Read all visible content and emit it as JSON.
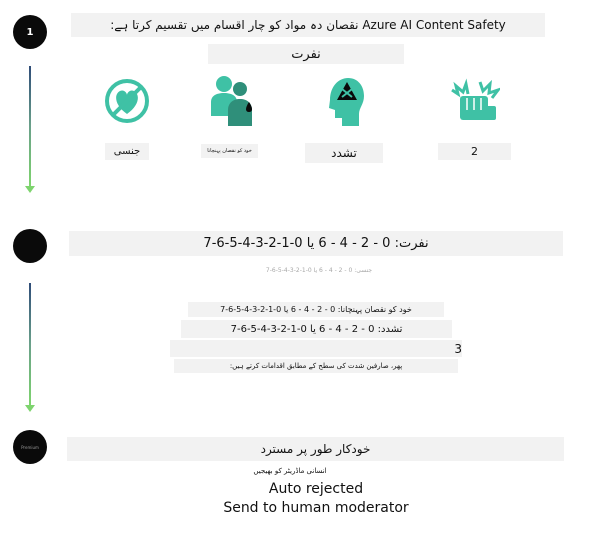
{
  "steps": [
    {
      "label": "1"
    },
    {
      "label": ""
    },
    {
      "label": "Premium"
    }
  ],
  "stage1": {
    "title": "Azure AI Content Safety نقصان دہ مواد کو چار اقسام میں تقسیم کرتا ہے:",
    "category_main": "نفرت",
    "categories": [
      {
        "icon": "no-sexual-icon",
        "label": "جنسی"
      },
      {
        "icon": "self-harm-icon",
        "label": "خود کو نقصان پہنچانا"
      },
      {
        "icon": "violence-icon",
        "label": "تشدد"
      },
      {
        "icon": "hate-fist-icon",
        "label": "2"
      }
    ],
    "colors": {
      "accent": "#3fc1a5"
    }
  },
  "stage2": {
    "hate_levels": "نفرت: 0 - 2 - 4 - 6 یا 0-1-2-3-4-5-6-7",
    "sexual_levels": "جنسی: 0 - 2 - 4 - 6 یا 0-1-2-3-4-5-6-7",
    "selfharm_levels": "خود کو نقصان پہنچانا: 0 - 2 - 4 - 6 یا 0-1-2-3-4-5-6-7",
    "violence_levels": "تشدد: 0 - 2 - 4 - 6 یا 0-1-2-3-4-5-6-7",
    "number_3": "3",
    "user_action": "پھر، صارفین شدت کی سطح کے مطابق اقدامات کرتے ہیں:"
  },
  "stage3": {
    "title": "خودکار طور پر مسترد",
    "send_ur": "انسانی ماڈریٹر کو بھیجیں",
    "auto_rejected": "Auto rejected",
    "send_human": "Send to human moderator"
  }
}
